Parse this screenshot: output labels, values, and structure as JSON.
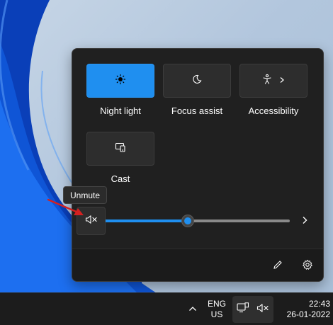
{
  "quick_settings": {
    "tiles": [
      {
        "label": "Night light",
        "icon": "night-light-icon",
        "active": true
      },
      {
        "label": "Focus assist",
        "icon": "moon-icon",
        "active": false
      },
      {
        "label": "Accessibility",
        "icon": "accessibility-icon",
        "active": false
      },
      {
        "label": "Cast",
        "icon": "cast-icon",
        "active": false
      }
    ],
    "tooltip": "Unmute",
    "volume": {
      "level_fraction": 0.45,
      "muted": true
    },
    "footer_icons": [
      "edit-icon",
      "gear-icon"
    ]
  },
  "taskbar": {
    "language_line1": "ENG",
    "language_line2": "US",
    "time": "22:43",
    "date": "26-01-2022",
    "icons": [
      "chevron-up-icon",
      "network-icon",
      "speaker-muted-icon"
    ]
  },
  "colors": {
    "accent": "#1f8ff0",
    "panel_bg": "#202020",
    "taskbar_bg": "#1c1c1c",
    "annotation_arrow": "#d42020"
  }
}
